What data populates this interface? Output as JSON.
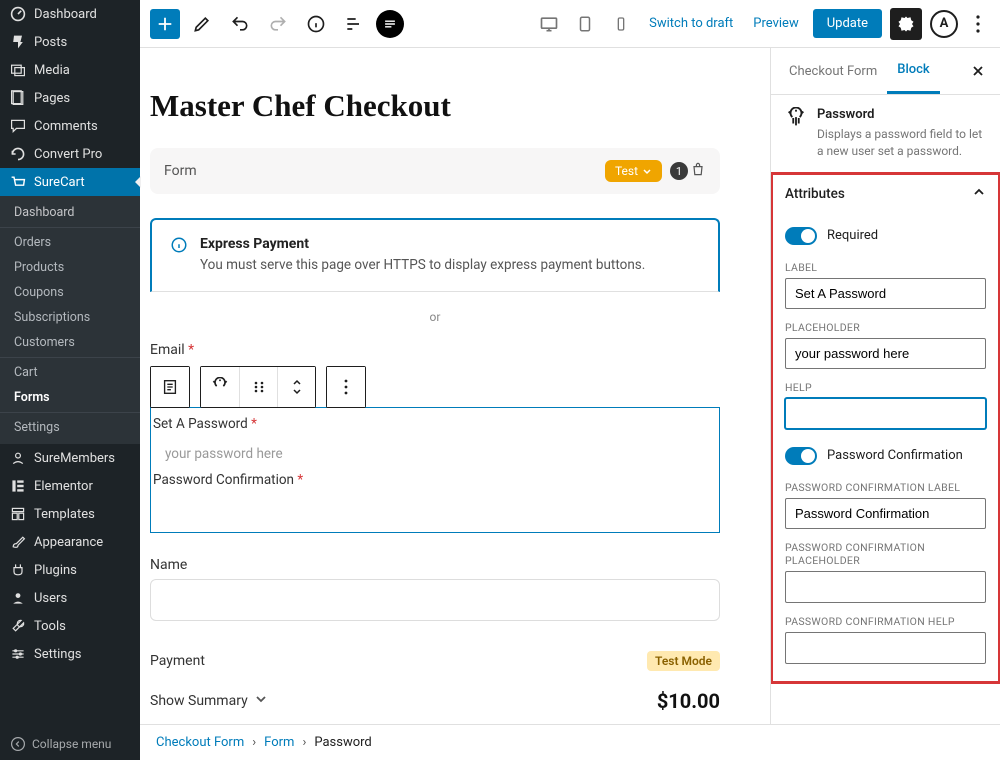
{
  "sidebar": {
    "items": [
      {
        "icon": "dashboard",
        "label": "Dashboard"
      },
      {
        "icon": "pin",
        "label": "Posts"
      },
      {
        "icon": "media",
        "label": "Media"
      },
      {
        "icon": "page",
        "label": "Pages"
      },
      {
        "icon": "comment",
        "label": "Comments"
      },
      {
        "icon": "convert",
        "label": "Convert Pro"
      },
      {
        "icon": "cart",
        "label": "SureCart"
      }
    ],
    "sub": [
      "Dashboard",
      "Orders",
      "Products",
      "Coupons",
      "Subscriptions",
      "Customers",
      "Cart",
      "Forms",
      "Settings"
    ],
    "lower": [
      {
        "icon": "members",
        "label": "SureMembers"
      },
      {
        "icon": "elementor",
        "label": "Elementor"
      },
      {
        "icon": "templates",
        "label": "Templates"
      },
      {
        "icon": "brush",
        "label": "Appearance"
      },
      {
        "icon": "plugin",
        "label": "Plugins"
      },
      {
        "icon": "users",
        "label": "Users"
      },
      {
        "icon": "wrench",
        "label": "Tools"
      },
      {
        "icon": "settings",
        "label": "Settings"
      }
    ],
    "collapse": "Collapse menu"
  },
  "topbar": {
    "switch_draft": "Switch to draft",
    "preview": "Preview",
    "update": "Update"
  },
  "page": {
    "title": "Master Chef Checkout"
  },
  "form_card": {
    "label": "Form",
    "test": "Test",
    "count": "1"
  },
  "express": {
    "title": "Express Payment",
    "text": "You must serve this page over HTTPS to display express payment buttons."
  },
  "or": "or",
  "fields": {
    "email": "Email",
    "set_pw": "Set A Password",
    "pw_placeholder": "your password here",
    "pw_confirm": "Password Confirmation",
    "name": "Name",
    "payment": "Payment",
    "testmode": "Test Mode",
    "summary": "Show Summary",
    "price": "$10.00"
  },
  "breadcrumb": [
    "Checkout Form",
    "Form",
    "Password"
  ],
  "inspector": {
    "tabs": [
      "Checkout Form",
      "Block"
    ],
    "header": {
      "title": "Password",
      "desc": "Displays a password field to let a new user set a password."
    },
    "attrs_title": "Attributes",
    "required_label": "Required",
    "label_label": "LABEL",
    "label_value": "Set A Password",
    "placeholder_label": "PLACEHOLDER",
    "placeholder_value": "your password here",
    "help_label": "HELP",
    "help_value": "",
    "pwc_toggle": "Password Confirmation",
    "pwc_label_label": "PASSWORD CONFIRMATION LABEL",
    "pwc_label_value": "Password Confirmation",
    "pwc_ph_label": "PASSWORD CONFIRMATION PLACEHOLDER",
    "pwc_help_label": "PASSWORD CONFIRMATION HELP"
  }
}
